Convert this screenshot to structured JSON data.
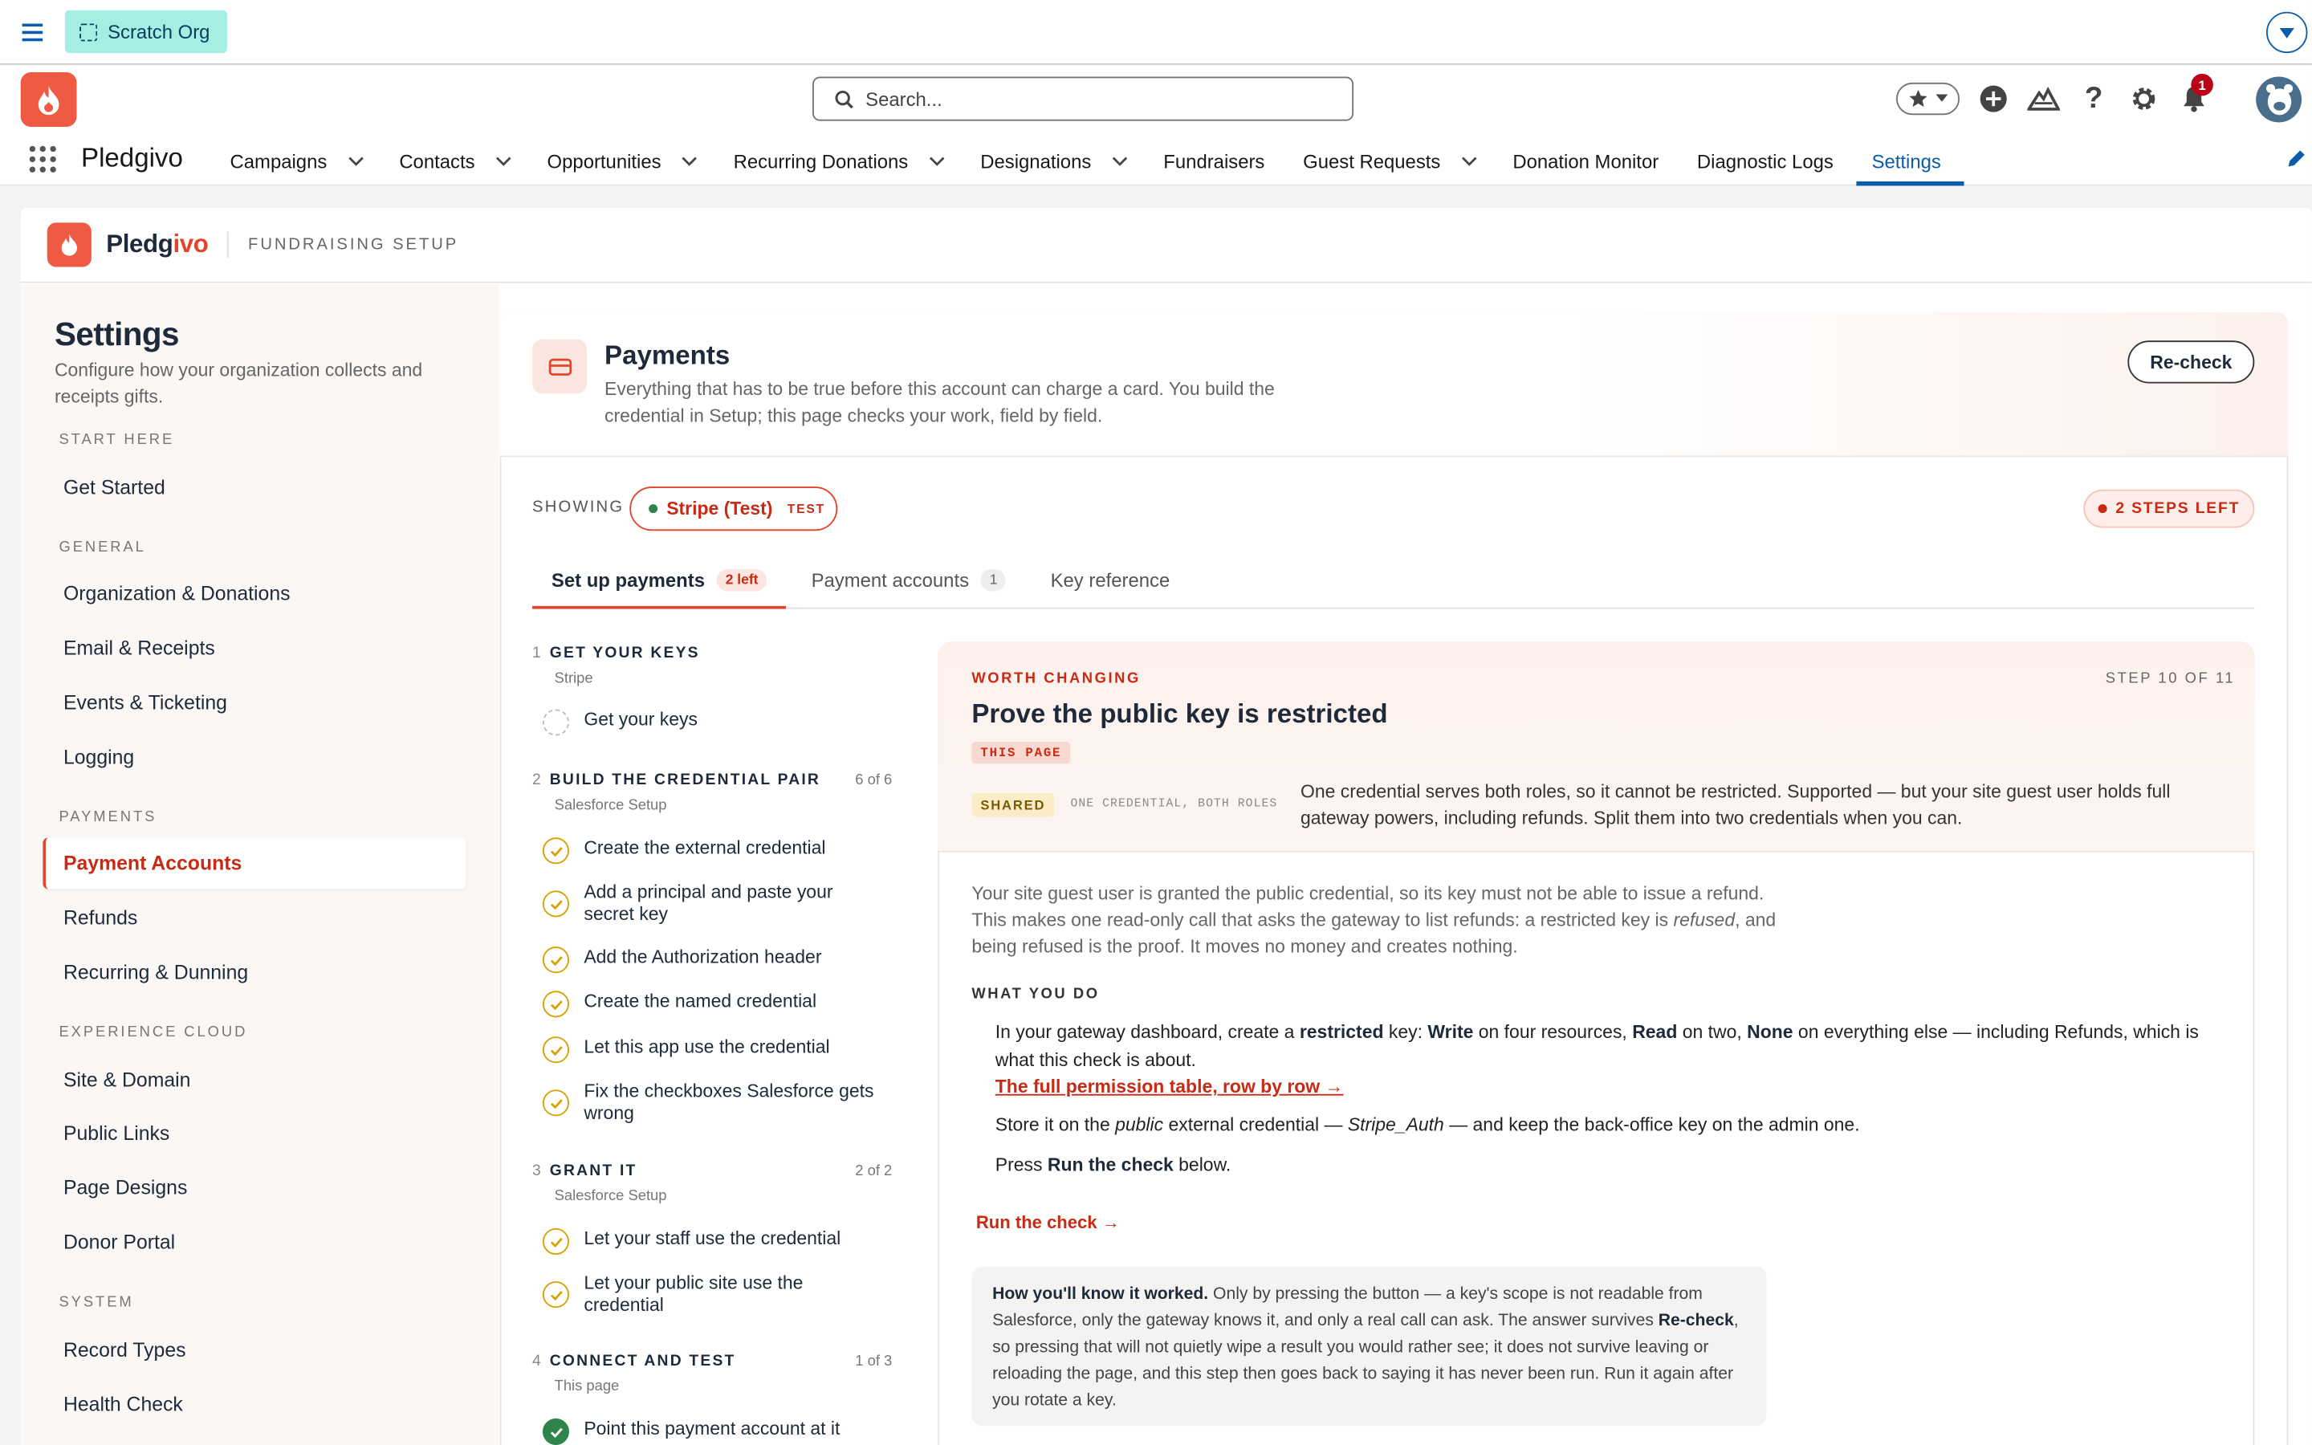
{
  "org": {
    "label": "Scratch Org"
  },
  "search": {
    "placeholder": "Search..."
  },
  "notifications": {
    "count": "1"
  },
  "app": {
    "name": "Pledgivo"
  },
  "nav": [
    {
      "label": "Campaigns",
      "dropdown": true
    },
    {
      "label": "Contacts",
      "dropdown": true
    },
    {
      "label": "Opportunities",
      "dropdown": true
    },
    {
      "label": "Recurring Donations",
      "dropdown": true
    },
    {
      "label": "Designations",
      "dropdown": true
    },
    {
      "label": "Fundraisers",
      "dropdown": false
    },
    {
      "label": "Guest Requests",
      "dropdown": true
    },
    {
      "label": "Donation Monitor",
      "dropdown": false
    },
    {
      "label": "Diagnostic Logs",
      "dropdown": false
    },
    {
      "label": "Settings",
      "dropdown": false,
      "active": true
    }
  ],
  "brand": {
    "name_a": "Pledg",
    "name_b": "ivo",
    "subtitle": "FUNDRAISING SETUP"
  },
  "sidebar": {
    "title": "Settings",
    "description": "Configure how your organization collects and receipts gifts.",
    "sections": {
      "start": "START HERE",
      "general": "GENERAL",
      "payments": "PAYMENTS",
      "experience": "EXPERIENCE CLOUD",
      "system": "SYSTEM"
    },
    "items": {
      "get_started": "Get Started",
      "org_donations": "Organization & Donations",
      "email_receipts": "Email & Receipts",
      "events": "Events & Ticketing",
      "logging": "Logging",
      "payment_accounts": "Payment Accounts",
      "refunds": "Refunds",
      "recurring": "Recurring & Dunning",
      "site_domain": "Site & Domain",
      "public_links": "Public Links",
      "page_designs": "Page Designs",
      "donor_portal": "Donor Portal",
      "record_types": "Record Types",
      "health_check": "Health Check"
    }
  },
  "payments": {
    "title": "Payments",
    "description": "Everything that has to be true before this account can charge a card. You build the credential in Setup; this page checks your work, field by field.",
    "recheck": "Re-check",
    "showing": "SHOWING",
    "account": "Stripe (Test)",
    "account_tag": "TEST",
    "steps_left": "2 STEPS LEFT"
  },
  "tabs": [
    {
      "label": "Set up payments",
      "count": "2 left"
    },
    {
      "label": "Payment accounts",
      "count": "1"
    },
    {
      "label": "Key reference",
      "count": ""
    }
  ],
  "groups": [
    {
      "num": "1",
      "title": "GET YOUR KEYS",
      "sub": "Stripe",
      "count": ""
    },
    {
      "num": "2",
      "title": "BUILD THE CREDENTIAL PAIR",
      "sub": "Salesforce Setup",
      "count": "6 of 6"
    },
    {
      "num": "3",
      "title": "GRANT IT",
      "sub": "Salesforce Setup",
      "count": "2 of 2"
    },
    {
      "num": "4",
      "title": "CONNECT AND TEST",
      "sub": "This page",
      "count": "1 of 3"
    }
  ],
  "steps": [
    "Get your keys",
    "Create the external credential",
    "Add a principal and paste your secret key",
    "Add the Authorization header",
    "Create the named credential",
    "Let this app use the credential",
    "Fix the checkboxes Salesforce gets wrong",
    "Let your staff use the credential",
    "Let your public site use the credential",
    "Point this payment account at it"
  ],
  "detail": {
    "eyebrow": "WORTH CHANGING",
    "step_of": "STEP 10 OF 11",
    "title": "Prove the public key is restricted",
    "this_page": "THIS PAGE",
    "shared": "SHARED",
    "one_credential": "ONE CREDENTIAL, BOTH ROLES",
    "shared_text": "One credential serves both roles, so it cannot be restricted. Supported — but your site guest user holds full gateway powers, including refunds. Split them into two credentials when you can.",
    "intro_a": "Your site guest user is granted the public credential, so its key must not be able to issue a refund. This makes one read-only call that asks the gateway to list refunds: a restricted key is ",
    "intro_em": "refused",
    "intro_b": ", and being refused is the proof. It moves no money and creates nothing.",
    "what_you_do": "WHAT YOU DO",
    "p1_a": "In your gateway dashboard, create a ",
    "p1_b": "restricted",
    "p1_c": " key: ",
    "p1_d": "Write",
    "p1_e": " on four resources, ",
    "p1_f": "Read",
    "p1_g": " on two, ",
    "p1_h": "None",
    "p1_i": " on everything else — including Refunds, which is what this check is about.",
    "link": "The full permission table, row by row →",
    "p2_a": "Store it on the ",
    "p2_b": "public",
    "p2_c": " external credential — ",
    "p2_d": "Stripe_Auth",
    "p2_e": " — and keep the back-office key on the admin one.",
    "p3_a": "Press ",
    "p3_b": "Run the check",
    "p3_c": " below.",
    "run": "Run the check →",
    "how_a": "How you'll know it worked.",
    "how_b": " Only by pressing the button — a key's scope is not readable from Salesforce, only the gateway knows it, and only a real call can ask. The answer survives ",
    "how_c": "Re-check",
    "how_d": ", so pressing that will not quietly wipe a result you would rather see; it does not survive leaving or reloading the page, and this step then goes back to saying it has never been run. Run it again after you rotate a key."
  },
  "colors": {
    "accent": "#e3442b",
    "nav_active": "#0b5cab",
    "scratch": "#a5eee3"
  }
}
